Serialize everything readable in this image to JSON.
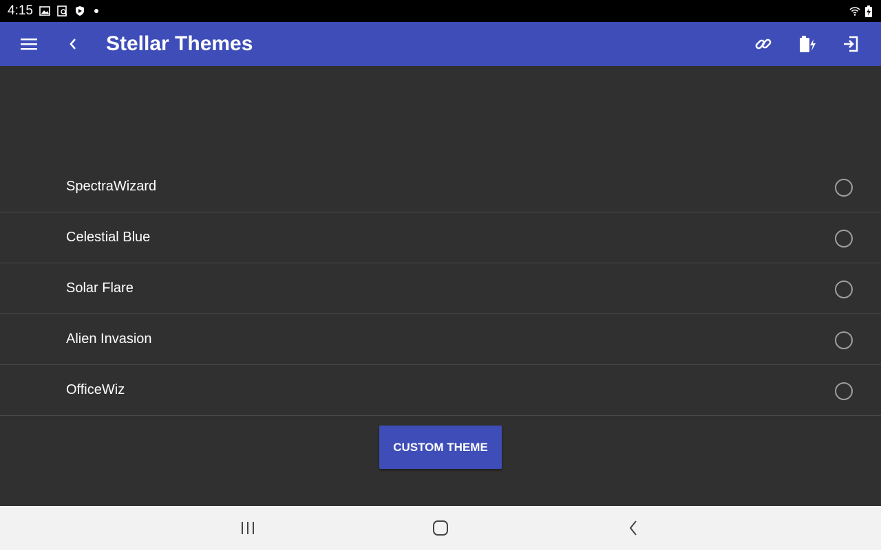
{
  "status_bar": {
    "time": "4:15",
    "icons": [
      "image-icon",
      "screenshot-icon",
      "shield-icon",
      "notification-dot-icon",
      "wifi-icon",
      "battery-icon"
    ]
  },
  "app_bar": {
    "title": "Stellar Themes",
    "color": "#3e4db8",
    "left_icons": [
      "menu-icon",
      "back-icon"
    ],
    "right_icons": [
      "link-icon",
      "battery-charging-icon",
      "logout-icon"
    ]
  },
  "themes": {
    "items": [
      {
        "label": "SpectraWizard",
        "selected": false
      },
      {
        "label": "Celestial Blue",
        "selected": false
      },
      {
        "label": "Solar Flare",
        "selected": false
      },
      {
        "label": "Alien Invasion",
        "selected": false
      },
      {
        "label": "OfficeWiz",
        "selected": false
      }
    ]
  },
  "custom_button": {
    "label": "CUSTOM THEME"
  },
  "nav_bar": {
    "icons": [
      "recents-icon",
      "home-icon",
      "back-icon"
    ]
  },
  "colors": {
    "background": "#303030",
    "accent": "#3e4db8",
    "divider": "#4a4a4a"
  }
}
